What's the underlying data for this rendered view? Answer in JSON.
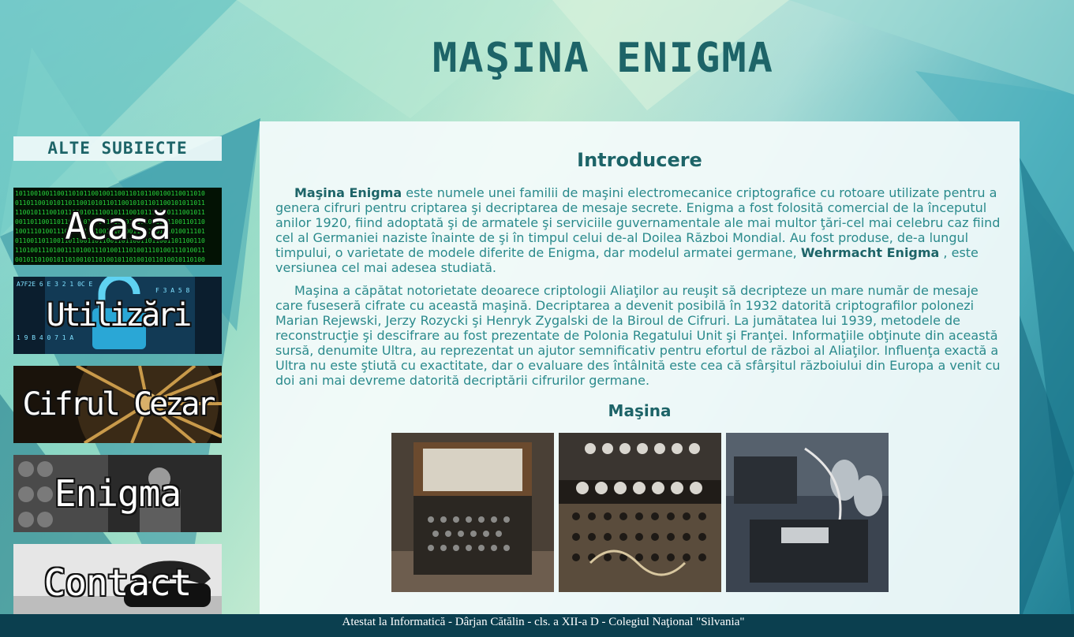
{
  "header": {
    "title": "MAŞINA ENIGMA"
  },
  "sidebar": {
    "heading": "ALTE SUBIECTE",
    "items": [
      {
        "label": "Acasă",
        "theme": "binary-code",
        "accent": "#27d23b"
      },
      {
        "label": "Utilizări",
        "theme": "digital-padlock",
        "accent": "#3cc3e8"
      },
      {
        "label": "Cifrul Cezar",
        "theme": "cipher-wheel",
        "accent": "#c99a4a"
      },
      {
        "label": "Enigma",
        "theme": "film-still",
        "accent": "#8a8a8a"
      },
      {
        "label": "Contact",
        "theme": "telephone",
        "accent": "#dcdcdc"
      }
    ]
  },
  "main": {
    "intro_title": "Introducere",
    "p1": {
      "lead": "Maşina Enigma",
      "text": " este numele unei familii de maşini electromecanice criptografice cu rotoare utilizate pentru a genera cifruri pentru criptarea şi decriptarea de mesaje secrete. Enigma a fost folosită comercial de la începutul anilor 1920, fiind adoptată şi de armatele şi serviciile guvernamentale ale mai multor ţări-cel mai celebru caz fiind cel al Germaniei naziste înainte de şi în timpul celui de-al Doilea Război Mondial. Au fost produse, de-a lungul timpului, o varietate de modele diferite de Enigma, dar modelul armatei germane, ",
      "emph": "Wehrmacht Enigma",
      "tail": " , este versiunea cel mai adesea studiată."
    },
    "p2": "Maşina a căpătat notorietate deoarece criptologii Aliaţilor au reuşit să decripteze un mare număr de mesaje care fuseseră cifrate cu această maşină. Decriptarea a devenit posibilă în 1932 datorită criptografilor polonezi Marian Rejewski, Jerzy Rozycki şi Henryk Zygalski de la Biroul de Cifruri. La jumătatea lui 1939, metodele de reconstrucţie şi descifrare au fost prezentate de Polonia Regatului Unit şi Franţei. Informaţiile obţinute din această sursă, denumite Ultra, au reprezentat un ajutor semnificativ pentru efortul de război al Aliaţilor. Influenţa exactă a Ultra nu este ştiută cu exactitate, dar o evaluare des întâlnită este cea că sfârşitul războiului din Europa a venit cu doi ani mai devreme datorită decriptării cifrurilor germane.",
    "machine_title": "Maşina",
    "photos": [
      {
        "subject": "enigma-machine-in-box"
      },
      {
        "subject": "enigma-keyboard-plugboard"
      },
      {
        "subject": "enigma-rotors-closeup"
      }
    ]
  },
  "footer": {
    "text": "Atestat la Informatică - Dârjan Cătălin - cls. a XII-a D - Colegiul Naţional \"Silvania\""
  },
  "colors": {
    "accent": "#1d6468",
    "body_text": "#2a8a8c",
    "footer_bg": "#0b3f4f"
  }
}
